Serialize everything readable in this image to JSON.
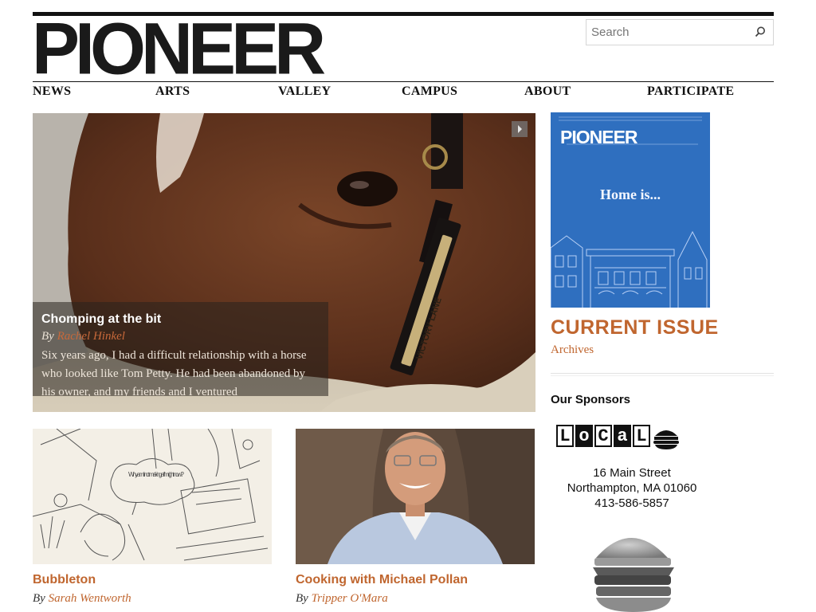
{
  "site": {
    "logo": "PIONEER"
  },
  "search": {
    "placeholder": "Search"
  },
  "nav": {
    "items": [
      "NEWS",
      "ARTS",
      "VALLEY",
      "CAMPUS",
      "ABOUT",
      "PARTICIPATE"
    ]
  },
  "hero": {
    "title": "Chomping at the bit",
    "by": "By",
    "author": "Rachel Hinkel",
    "excerpt": "Six years ago, I had a difficult relationship with a horse who looked like Tom Petty. He had been abandoned by his owner, and my friends and I ventured",
    "halter_text": "VICTORY LANE"
  },
  "cards": [
    {
      "title": "Bubbleton",
      "by": "By",
      "author": "Sarah Wentworth",
      "sketch_text": "Why am I not making a film right now?"
    },
    {
      "title": "Cooking with Michael Pollan",
      "by": "By",
      "author": "Tripper O'Mara"
    }
  ],
  "sidebar": {
    "cover_logo": "PIONEER",
    "cover_tagline": "Home is...",
    "current_issue": "CURRENT ISSUE",
    "archives": "Archives",
    "sponsors_title": "Our Sponsors",
    "sponsor": {
      "logo_letters": [
        "L",
        "o",
        "C",
        "a",
        "L"
      ],
      "address_line1": "16 Main Street",
      "address_line2": "Northampton, MA 01060",
      "phone": "413-586-5857"
    }
  },
  "colors": {
    "accent": "#c0662f",
    "text": "#111111",
    "cover_blue": "#2f6fbf"
  }
}
